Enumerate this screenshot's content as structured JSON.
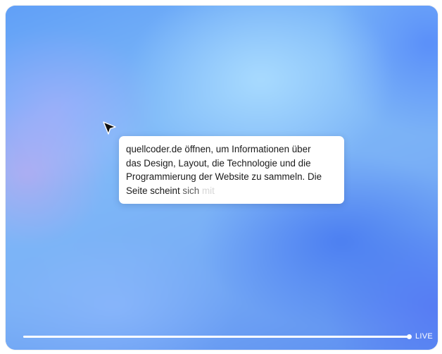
{
  "caption": {
    "line1": "quellcoder.de öffnen, um Informationen über",
    "line2": "das Design, Layout, die Technologie und die",
    "line3": "Programmierung der Website zu sammeln. Die",
    "line4_main": "Seite scheint ",
    "line4_fade1": "sich",
    "line4_fade2": " mit"
  },
  "player": {
    "live_label": "LIVE",
    "progress_fraction": 1.0
  },
  "icons": {
    "cursor": "mouse-pointer-icon"
  },
  "colors": {
    "background_primary": "#6aa6f5",
    "caption_background": "#ffffff",
    "caption_text": "#1a1a1a",
    "progress": "#ffffff"
  }
}
